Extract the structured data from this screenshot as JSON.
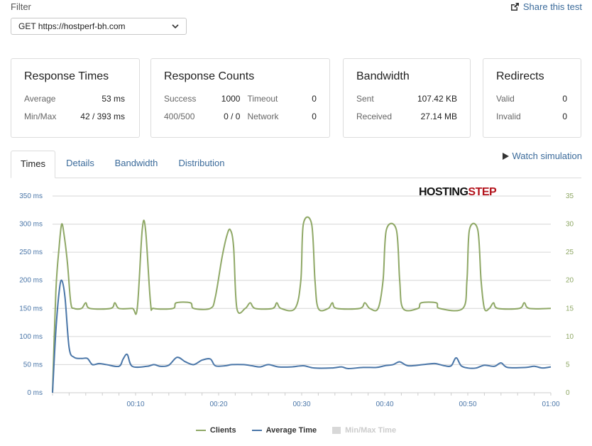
{
  "filter": {
    "label": "Filter",
    "selected": "GET https://hostperf-bh.com",
    "share_label": "Share this test"
  },
  "cards": {
    "response_times": {
      "title": "Response Times",
      "avg_label": "Average",
      "avg_value": "53 ms",
      "minmax_label": "Min/Max",
      "minmax_value": "42 / 393 ms"
    },
    "response_counts": {
      "title": "Response Counts",
      "success_label": "Success",
      "success_value": "1000",
      "timeout_label": "Timeout",
      "timeout_value": "0",
      "err_label": "400/500",
      "err_value": "0 / 0",
      "network_label": "Network",
      "network_value": "0"
    },
    "bandwidth": {
      "title": "Bandwidth",
      "sent_label": "Sent",
      "sent_value": "107.42 KB",
      "recv_label": "Received",
      "recv_value": "27.14 MB"
    },
    "redirects": {
      "title": "Redirects",
      "valid_label": "Valid",
      "valid_value": "0",
      "invalid_label": "Invalid",
      "invalid_value": "0"
    }
  },
  "tabs": [
    "Times",
    "Details",
    "Bandwidth",
    "Distribution"
  ],
  "watch_label": "Watch simulation",
  "logo": {
    "part1": "HOSTING",
    "part2": "STEP",
    "color1": "#111111",
    "color2": "#b3121b"
  },
  "chart_data": {
    "type": "line",
    "y_left_ticks": [
      "0 ms",
      "50 ms",
      "100 ms",
      "150 ms",
      "200 ms",
      "250 ms",
      "300 ms",
      "350 ms"
    ],
    "y_right_ticks": [
      "0",
      "5",
      "10",
      "15",
      "20",
      "25",
      "30",
      "35"
    ],
    "x_ticks": [
      "00:10",
      "00:20",
      "00:30",
      "00:40",
      "00:50",
      "01:00"
    ],
    "ylim_left": [
      0,
      350
    ],
    "ylim_right": [
      0,
      35
    ],
    "xlim_seconds": [
      0,
      60
    ],
    "grid": true,
    "legend_position": "bottom-center",
    "series": [
      {
        "name": "Clients",
        "axis": "right",
        "color": "#8fa866",
        "points": [
          [
            0,
            0
          ],
          [
            0.4,
            18
          ],
          [
            0.8,
            26
          ],
          [
            1.1,
            30
          ],
          [
            1.4,
            28
          ],
          [
            1.8,
            23
          ],
          [
            2.2,
            16
          ],
          [
            2.6,
            15
          ],
          [
            3.5,
            15
          ],
          [
            4.0,
            16
          ],
          [
            4.5,
            15
          ],
          [
            7.0,
            15
          ],
          [
            7.5,
            16
          ],
          [
            8.0,
            15
          ],
          [
            9.6,
            15
          ],
          [
            10.2,
            15
          ],
          [
            10.8,
            29
          ],
          [
            11.2,
            29
          ],
          [
            11.8,
            16
          ],
          [
            12.2,
            15
          ],
          [
            14.5,
            15
          ],
          [
            14.9,
            16
          ],
          [
            16.6,
            16
          ],
          [
            17.0,
            15
          ],
          [
            19.0,
            15
          ],
          [
            19.6,
            17
          ],
          [
            20.4,
            24
          ],
          [
            21.0,
            28
          ],
          [
            21.4,
            29
          ],
          [
            21.8,
            26
          ],
          [
            22.2,
            15
          ],
          [
            23.2,
            15
          ],
          [
            23.8,
            16
          ],
          [
            24.4,
            15
          ],
          [
            26.5,
            15
          ],
          [
            27.0,
            16
          ],
          [
            27.5,
            15
          ],
          [
            29.2,
            15
          ],
          [
            29.9,
            20
          ],
          [
            30.2,
            30
          ],
          [
            31.2,
            30
          ],
          [
            31.6,
            20
          ],
          [
            32.0,
            15
          ],
          [
            33.2,
            15
          ],
          [
            33.7,
            16
          ],
          [
            34.2,
            15
          ],
          [
            37.0,
            15
          ],
          [
            37.6,
            16
          ],
          [
            38.2,
            15
          ],
          [
            39.2,
            15
          ],
          [
            39.8,
            20
          ],
          [
            40.2,
            29
          ],
          [
            41.4,
            29
          ],
          [
            41.8,
            20
          ],
          [
            42.2,
            15
          ],
          [
            44.0,
            15
          ],
          [
            44.4,
            16
          ],
          [
            46.2,
            16
          ],
          [
            46.6,
            15
          ],
          [
            49.4,
            15
          ],
          [
            49.9,
            20
          ],
          [
            50.2,
            29
          ],
          [
            51.2,
            29
          ],
          [
            51.6,
            20
          ],
          [
            52.0,
            15
          ],
          [
            52.6,
            15
          ],
          [
            53.1,
            16
          ],
          [
            53.6,
            15
          ],
          [
            56.2,
            15
          ],
          [
            56.8,
            16
          ],
          [
            57.4,
            15
          ],
          [
            60,
            15
          ]
        ]
      },
      {
        "name": "Average Time",
        "axis": "left",
        "color": "#4a76a8",
        "points": [
          [
            0,
            0
          ],
          [
            0.4,
            110
          ],
          [
            0.8,
            180
          ],
          [
            1.1,
            200
          ],
          [
            1.5,
            170
          ],
          [
            2.0,
            80
          ],
          [
            2.6,
            63
          ],
          [
            3.5,
            61
          ],
          [
            4.2,
            61
          ],
          [
            4.8,
            50
          ],
          [
            5.6,
            52
          ],
          [
            6.5,
            50
          ],
          [
            8.0,
            47
          ],
          [
            8.5,
            60
          ],
          [
            9.0,
            68
          ],
          [
            9.6,
            47
          ],
          [
            11.4,
            47
          ],
          [
            12.2,
            50
          ],
          [
            13.0,
            47
          ],
          [
            14.0,
            49
          ],
          [
            15.0,
            63
          ],
          [
            16.0,
            55
          ],
          [
            17.0,
            50
          ],
          [
            18.0,
            58
          ],
          [
            19.0,
            60
          ],
          [
            19.6,
            48
          ],
          [
            20.8,
            48
          ],
          [
            21.6,
            50
          ],
          [
            23.0,
            50
          ],
          [
            24.0,
            48
          ],
          [
            25.0,
            46
          ],
          [
            26.0,
            50
          ],
          [
            27.2,
            46
          ],
          [
            28.8,
            46
          ],
          [
            30.2,
            48
          ],
          [
            31.5,
            44
          ],
          [
            33.6,
            44
          ],
          [
            34.8,
            46
          ],
          [
            35.6,
            43
          ],
          [
            37.4,
            45
          ],
          [
            39.0,
            45
          ],
          [
            40.0,
            48
          ],
          [
            41.0,
            50
          ],
          [
            41.8,
            55
          ],
          [
            42.8,
            48
          ],
          [
            44.6,
            50
          ],
          [
            46.0,
            52
          ],
          [
            47.2,
            48
          ],
          [
            48.0,
            48
          ],
          [
            48.6,
            62
          ],
          [
            49.2,
            48
          ],
          [
            50.0,
            44
          ],
          [
            51.0,
            44
          ],
          [
            52.0,
            49
          ],
          [
            53.2,
            47
          ],
          [
            54.0,
            53
          ],
          [
            54.8,
            45
          ],
          [
            57.0,
            45
          ],
          [
            58.0,
            47
          ],
          [
            59.0,
            44
          ],
          [
            60,
            46
          ]
        ]
      },
      {
        "name": "Min/Max Time",
        "axis": "left",
        "color": "#d8d8d8",
        "points": []
      }
    ]
  },
  "legend": {
    "clients_label": "Clients",
    "avg_label": "Average Time",
    "minmax_label": "Min/Max Time",
    "clients_color": "#8fa866",
    "avg_color": "#4a76a8",
    "minmax_color": "#d8d8d8"
  }
}
